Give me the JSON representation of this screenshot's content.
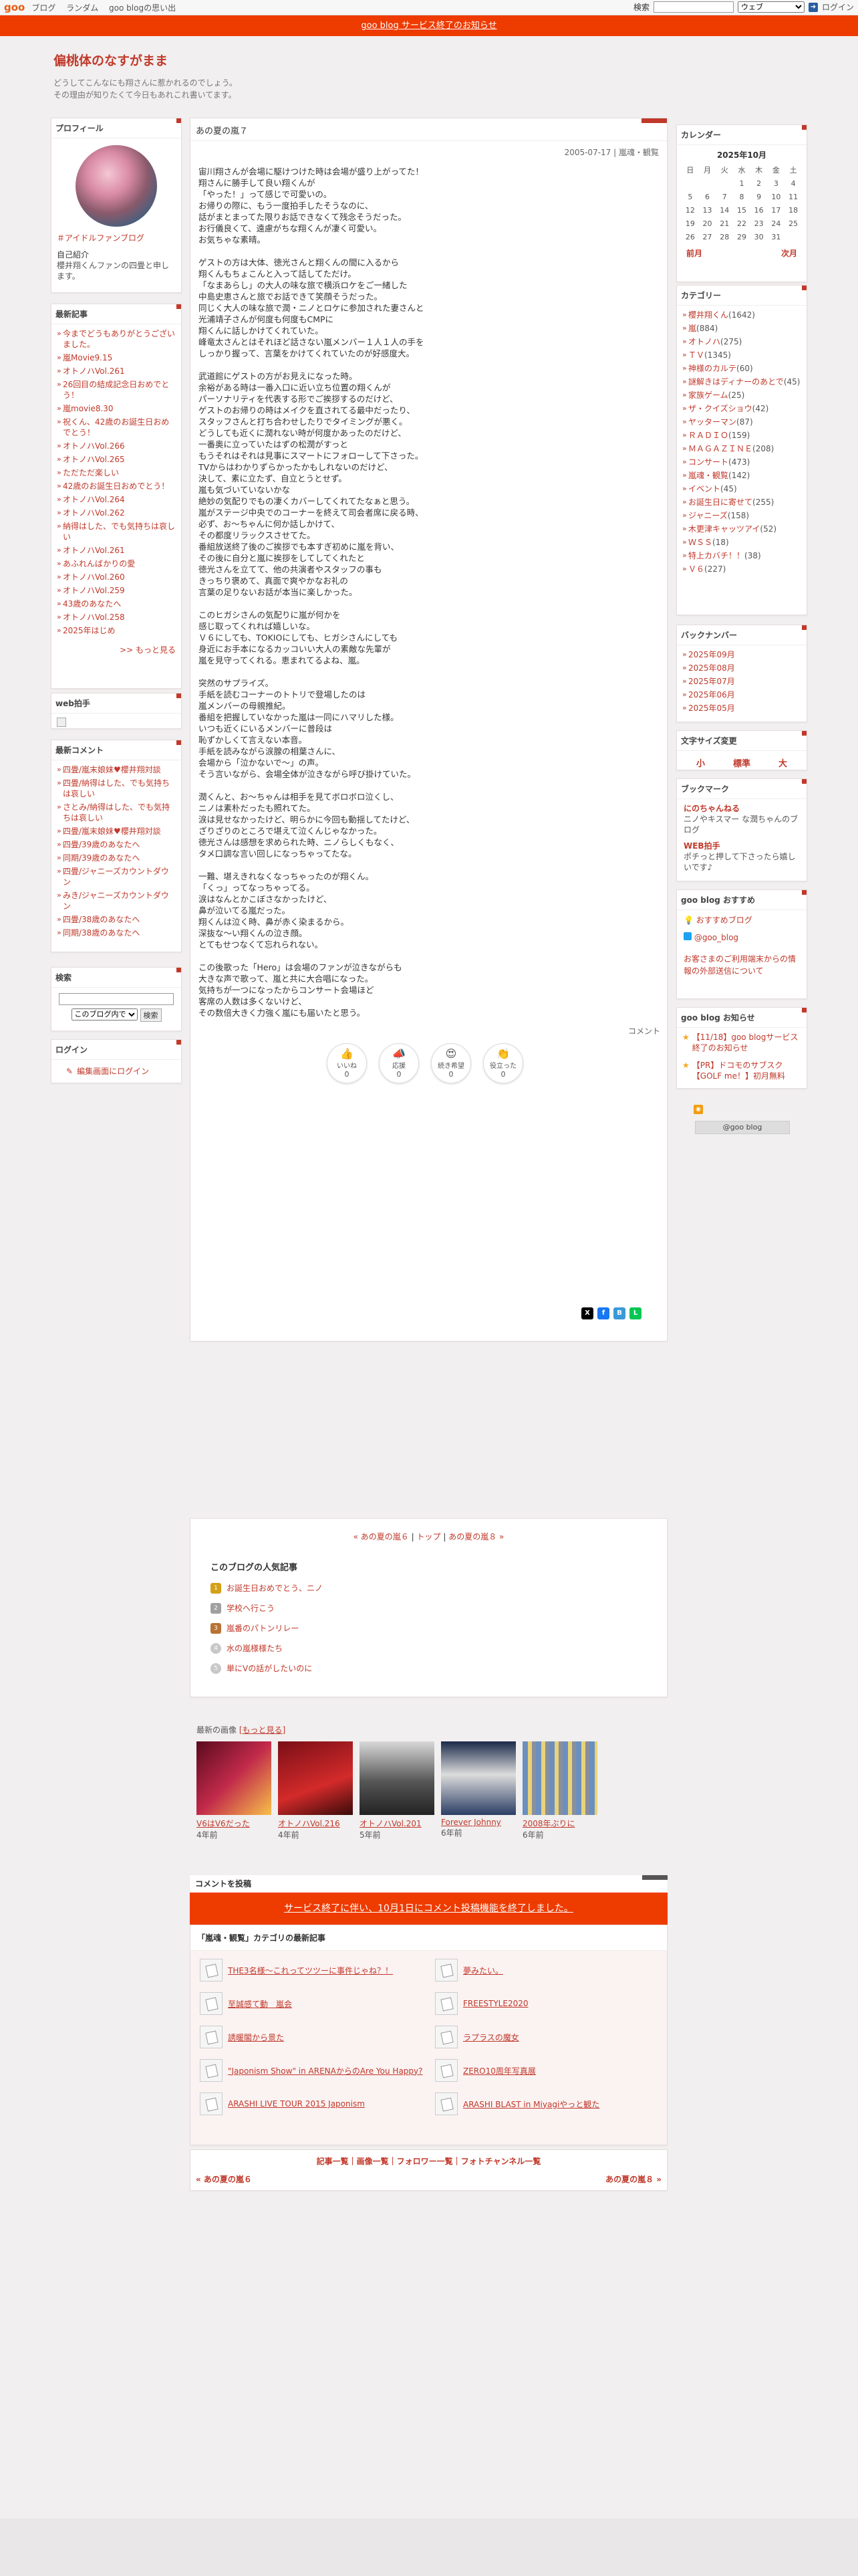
{
  "topbar": {
    "logo": "goo",
    "nav": [
      "ブログ",
      "ランダム",
      "goo blogの思い出"
    ],
    "search_label": "検索",
    "search_placeholder": "",
    "search_scope": "ウェブ",
    "login": "ログイン"
  },
  "notice": "goo blog サービス終了のお知らせ",
  "blog": {
    "title": "偏桃体のなすがまま",
    "desc1": "どうしてこんなにも翔さんに惹かれるのでしょう。",
    "desc2": "その理由が知りたくて今日もあれこれ書いてます。"
  },
  "profile": {
    "heading": "プロフィール",
    "name": "＃アイドルファンブログ",
    "intro_label": "自己紹介",
    "intro": "櫻井翔くんファンの四畳と申します。"
  },
  "recent": {
    "heading": "最新記事",
    "items": [
      "今までどうもありがとうございました。",
      "嵐Movie9.15",
      "オトノハVol.261",
      "26回目の結成記念日おめでとう！",
      "嵐movie8.30",
      "祝くん、42歳のお誕生日おめでとう！",
      "オトノハVol.266",
      "オトノハVol.265",
      "ただただ楽しい",
      "42歳のお誕生日おめでとう！",
      "オトノハVol.264",
      "オトノハVol.262",
      "納得はした、でも気持ちは哀しい",
      "オトノハVol.261",
      "あふれんばかりの愛",
      "オトノハVol.260",
      "オトノハVol.259",
      "43歳のあなたへ",
      "オトノハVol.258",
      "2025年はじめ"
    ],
    "more": ">> もっと見る"
  },
  "webclap": {
    "heading": "web拍手"
  },
  "comments": {
    "heading": "最新コメント",
    "items": [
      "四畳/嵐末娘妹♥櫻井翔対談",
      "四畳/納得はした、でも気持ちは哀しい",
      "さとみ/納得はした、でも気持ちは哀しい",
      "四畳/嵐末娘妹♥櫻井翔対談",
      "四畳/39歳のあなたへ",
      "同期/39歳のあなたへ",
      "四畳/ジャニーズカウントダウン",
      "みき/ジャニーズカウントダウン",
      "四畳/38歳のあなたへ",
      "同期/38歳のあなたへ"
    ]
  },
  "search": {
    "heading": "検索",
    "scope": "このブログ内で",
    "button": "検索"
  },
  "login_panel": {
    "heading": "ログイン",
    "link": "編集画面にログイン"
  },
  "post": {
    "title": "あの夏の嵐７",
    "date": "2005-07-17",
    "category": "嵐魂・観覧",
    "body": "宙川翔さんが会場に駆けつけた時は会場が盛り上がってた！\n翔さんに勝手して良い翔くんが\n「やった！」って感じで可愛いの。\nお帰りの際に、もう一度拍手したそうなのに、\n話がまとまってた限りお話できなくて残念そうだった。\nお行儀良くて、遠慮がちな翔くんが凄く可愛い。\nお気ちゃな素晴。\n\nゲストの方は大体、徳光さんと翔くんの間に入るから\n翔くんもちょこんと入って話してただけ。\n「なまあらし」の大人の味な旅で横浜ロケをご一緒した\n中島史恵さんと旅でお話できて笑顔そうだった。\n同じく大人の味な旅で潤・ニノとロケに参加された妻さんと\n光浦靖子さんが何度も何度もCMPに\n翔くんに話しかけてくれていた。\n峰竜太さんとはそれほど話さない嵐メンバー１人１人の手を\nしっかり握って、言葉をかけてくれていたのが好感度大。\n\n武道館にゲストの方がお見えになった時。\n余裕がある時は一番入口に近い立ち位置の翔くんが\nパーソナリティを代表する形でご挨拶するのだけど、\nゲストのお帰りの時はメイクを直されてる最中だったり、\nスタッフさんと打ち合わせしたりでタイミングが悪く。\nどうしても近くに潤れない時が何度かあったのだけど、\n一番奥に立っていたはずの松潤がすっと\nもうそれはそれは見事にスマートにフォローして下さった。\nTVからはわかりずらかったかもしれないのだけど、\n決して、素に立たず、自立とうとせず。\n嵐も気づいていないかな\n絶妙の気配りでもの凄くカバーしてくれてたなぁと思う。\n嵐がステージ中央でのコーナーを終えて司会者席に戻る時、\n必ず、お〜ちゃんに何か話しかけて、\nその都度リラックスさせてた。\n番組放送終了後のご挨拶でも本すぎ初めに嵐を背い、\nその後に自分と嵐に挨拶をしてしてくれたと\n徳光さんを立てて、他の共演者やスタッフの事も\nきっちり褒めて、真面で爽やかなお礼の\n言葉の足りないお話が本当に楽しかった。\n\nこのヒガシさんの気配りに嵐が何かを\n感じ取ってくれれば嬉しいな。\nＶ６にしても、TOKIOにしても、ヒガシさんにしても\n身近にお手本になるカッコいい大人の素敵な先輩が\n嵐を見守ってくれる。恵まれてるよね、嵐。\n\n突然のサプライズ。\n手紙を読むコーナーのトトリで登場したのは\n嵐メンバーの母親推紀。\n番組を把握していなかった嵐は一同にハマリした様。\nいつも近くにいるメンバーに普段は\n恥ずかしくて言えない本音。\n手紙を読みながら涙腺の相葉さんに、\n会場から「泣かないで〜」の声。\nそう言いながら、会場全体が泣きながら呼び掛けていた。\n\n潤くんと、お〜ちゃんは相手を見てボロボロ泣くし、\nニノは素朴だったも照れてた。\n涙は見せなかったけど、明らかに今回も動揺してたけど、\nざりざりのところで堪えて泣くんじゃなかった。\n徳光さんは感想を求められた時、ニノらしくもなく、\nタメ口調な言い回しになっちゃってたな。\n\n一難、堪えきれなくなっちゃったのが翔くん。\n「くっ」ってなっちゃってる。\n涙はなんとかこぼさなかったけど、\n鼻が泣いてる嵐だった。\n翔くんは泣く時、鼻が赤く染まるから。\n深抜な〜い翔くんの泣き顔。\nとてもせつなくて忘れられない。\n\nこの後歌った「Hero」は会場のファンが泣きながらも\n大きな声で歌って、嵐と共に大合唱になった。\n気持ちが一つになったからコンサート会場ほど\n客席の人数は多くないけど、\nその数倍大きく力強く嵐にも届いたと思う。",
    "comment_link": "コメント",
    "reactions": [
      {
        "label": "いいね",
        "count": "0",
        "icon": "thumbs-up-icon"
      },
      {
        "label": "応援",
        "count": "0",
        "icon": "megaphone-icon"
      },
      {
        "label": "続き希望",
        "count": "0",
        "icon": "heart-eyes-icon"
      },
      {
        "label": "役立った",
        "count": "0",
        "icon": "clap-icon"
      }
    ],
    "pager": {
      "prev": "« あの夏の嵐６",
      "top": "トップ",
      "next": "あの夏の嵐８ »",
      "sep": "|"
    }
  },
  "popular": {
    "heading": "このブログの人気記事",
    "items": [
      "お誕生日おめでとう、ニノ",
      "学校へ行こう",
      "嵐番のパトンリレー",
      "水の嵐様様たち",
      "単にVの話がしたいのに"
    ]
  },
  "images": {
    "heading": "最新の画像",
    "more": "[もっと見る]",
    "items": [
      {
        "cap": "V6はV6だった",
        "ago": "4年前",
        "color": "#8a1530"
      },
      {
        "cap": "オトノハVol.216",
        "ago": "4年前",
        "color": "#a61a24"
      },
      {
        "cap": "オトノハVol.201",
        "ago": "5年前",
        "color": "#6f6f6f"
      },
      {
        "cap": "Forever Johnny",
        "ago": "6年前",
        "color": "#2c3e66"
      },
      {
        "cap": "2008年ぶりに",
        "ago": "6年前",
        "color": "#7a7f8c"
      }
    ]
  },
  "post_comment": {
    "heading": "コメントを投稿",
    "notice": "サービス終了に伴い、10月1日にコメント投稿機能を終了しました。"
  },
  "category_posts": {
    "heading": "「嵐魂・観覧」カテゴリの最新記事",
    "items": [
      "THE3名様〜これってツツーに事件じゃね？！",
      "夢みたい。",
      "至誠感て動　嵐会",
      "FREESTYLE2020",
      "誘暖閣から景た",
      "ラプラスの魔女",
      "\"Japonism Show\" in ARENAからのAre You Happy?",
      "ZERO10周年写真展",
      "ARASHI LIVE TOUR 2015 Japonism",
      "ARASHI BLAST in Miyagiやっと観た"
    ]
  },
  "footer": {
    "links": "記事一覧｜画像一覧｜フォロワー一覧｜フォトチャンネル一覧",
    "prev": "« あの夏の嵐６",
    "next": "あの夏の嵐８ »"
  },
  "calendar": {
    "heading": "カレンダー",
    "month": "2025年10月",
    "days": [
      "日",
      "月",
      "火",
      "水",
      "木",
      "金",
      "土"
    ],
    "weeks": [
      [
        "",
        "",
        "",
        "1",
        "2",
        "3",
        "4"
      ],
      [
        "5",
        "6",
        "7",
        "8",
        "9",
        "10",
        "11"
      ],
      [
        "12",
        "13",
        "14",
        "15",
        "16",
        "17",
        "18"
      ],
      [
        "19",
        "20",
        "21",
        "22",
        "23",
        "24",
        "25"
      ],
      [
        "26",
        "27",
        "28",
        "29",
        "30",
        "31",
        ""
      ]
    ],
    "prev": "前月",
    "next": "次月"
  },
  "categories": {
    "heading": "カテゴリー",
    "items": [
      {
        "name": "櫻井翔くん",
        "cnt": "(1642)"
      },
      {
        "name": "嵐",
        "cnt": "(884)"
      },
      {
        "name": "オトノハ",
        "cnt": "(275)"
      },
      {
        "name": "ＴＶ",
        "cnt": "(1345)"
      },
      {
        "name": "神様のカルテ",
        "cnt": "(60)"
      },
      {
        "name": "謎解きはディナーのあとで",
        "cnt": "(45)"
      },
      {
        "name": "家族ゲーム",
        "cnt": "(25)"
      },
      {
        "name": "ザ・クイズショウ",
        "cnt": "(42)"
      },
      {
        "name": "ヤッターマン",
        "cnt": "(87)"
      },
      {
        "name": "ＲＡＤＩＯ",
        "cnt": "(159)"
      },
      {
        "name": "ＭＡＧＡＺＩＮＥ",
        "cnt": "(208)"
      },
      {
        "name": "コンサート",
        "cnt": "(473)"
      },
      {
        "name": "嵐魂・観覧",
        "cnt": "(142)"
      },
      {
        "name": "イベント",
        "cnt": "(45)"
      },
      {
        "name": "お誕生日に寄せて",
        "cnt": "(255)"
      },
      {
        "name": "ジャニーズ",
        "cnt": "(158)"
      },
      {
        "name": "木更津キャッツアイ",
        "cnt": "(52)"
      },
      {
        "name": "ＷＳＳ",
        "cnt": "(18)"
      },
      {
        "name": "特上カバチ！！",
        "cnt": "(38)"
      },
      {
        "name": "Ｖ６",
        "cnt": "(227)"
      }
    ]
  },
  "backnumber": {
    "heading": "バックナンバー",
    "items": [
      "2025年09月",
      "2025年08月",
      "2025年07月",
      "2025年06月",
      "2025年05月"
    ]
  },
  "fontsize": {
    "heading": "文字サイズ変更",
    "small": "小",
    "normal": "標準",
    "large": "大"
  },
  "bookmarks": {
    "heading": "ブックマーク",
    "items": [
      {
        "name": "にのちゃんねる",
        "desc": "ニノやキスマー な潤ちゃんのブログ"
      },
      {
        "name": "WEB拍手",
        "desc": "ポチっと押して下さったら嬉しいです♪"
      }
    ]
  },
  "goo_recommend": {
    "heading": "goo blog おすすめ",
    "items": [
      "おすすめブログ",
      "@goo_blog"
    ],
    "help": "お客さまのご利用端末からの情報の外部送信について"
  },
  "goo_notice": {
    "heading": "goo blog お知らせ",
    "items": [
      "【11/18】goo blogサービス終了のお知らせ",
      "【PR】ドコモのサブスク【GOLF me！】初月無料"
    ],
    "badge": "@goo blog"
  },
  "colors": {
    "accent": "#c0392b",
    "notice_bg": "#ee3b00",
    "page_bg": "#f1efef"
  }
}
